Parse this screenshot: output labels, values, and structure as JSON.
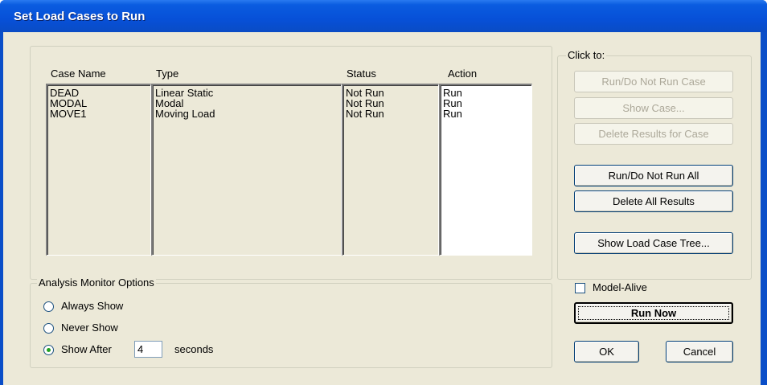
{
  "window": {
    "title": "Set Load Cases to Run"
  },
  "cases_table": {
    "headers": {
      "case_name": "Case Name",
      "type": "Type",
      "status": "Status",
      "action": "Action"
    },
    "rows": [
      {
        "case_name": "DEAD",
        "type": "Linear Static",
        "status": "Not Run",
        "action": "Run"
      },
      {
        "case_name": "MODAL",
        "type": "Modal",
        "status": "Not Run",
        "action": "Run"
      },
      {
        "case_name": "MOVE1",
        "type": "Moving Load",
        "status": "Not Run",
        "action": "Run"
      }
    ]
  },
  "click_to": {
    "caption": "Click to:",
    "run_do_not_run_case": "Run/Do Not Run Case",
    "show_case": "Show Case...",
    "delete_results_for_case": "Delete Results for Case",
    "run_do_not_run_all": "Run/Do Not Run All",
    "delete_all_results": "Delete All Results",
    "show_load_case_tree": "Show Load Case Tree..."
  },
  "monitor": {
    "caption": "Analysis Monitor Options",
    "always_show": "Always Show",
    "never_show": "Never Show",
    "show_after": "Show After",
    "seconds_value": "4",
    "seconds_label": "seconds",
    "selected": "show_after"
  },
  "model_alive": {
    "label": "Model-Alive",
    "checked": false
  },
  "buttons": {
    "run_now": "Run Now",
    "ok": "OK",
    "cancel": "Cancel"
  },
  "colors": {
    "title_bar": "#0a5ce0",
    "dialog_bg": "#ece9d8",
    "checked_radio": "#21a121"
  }
}
